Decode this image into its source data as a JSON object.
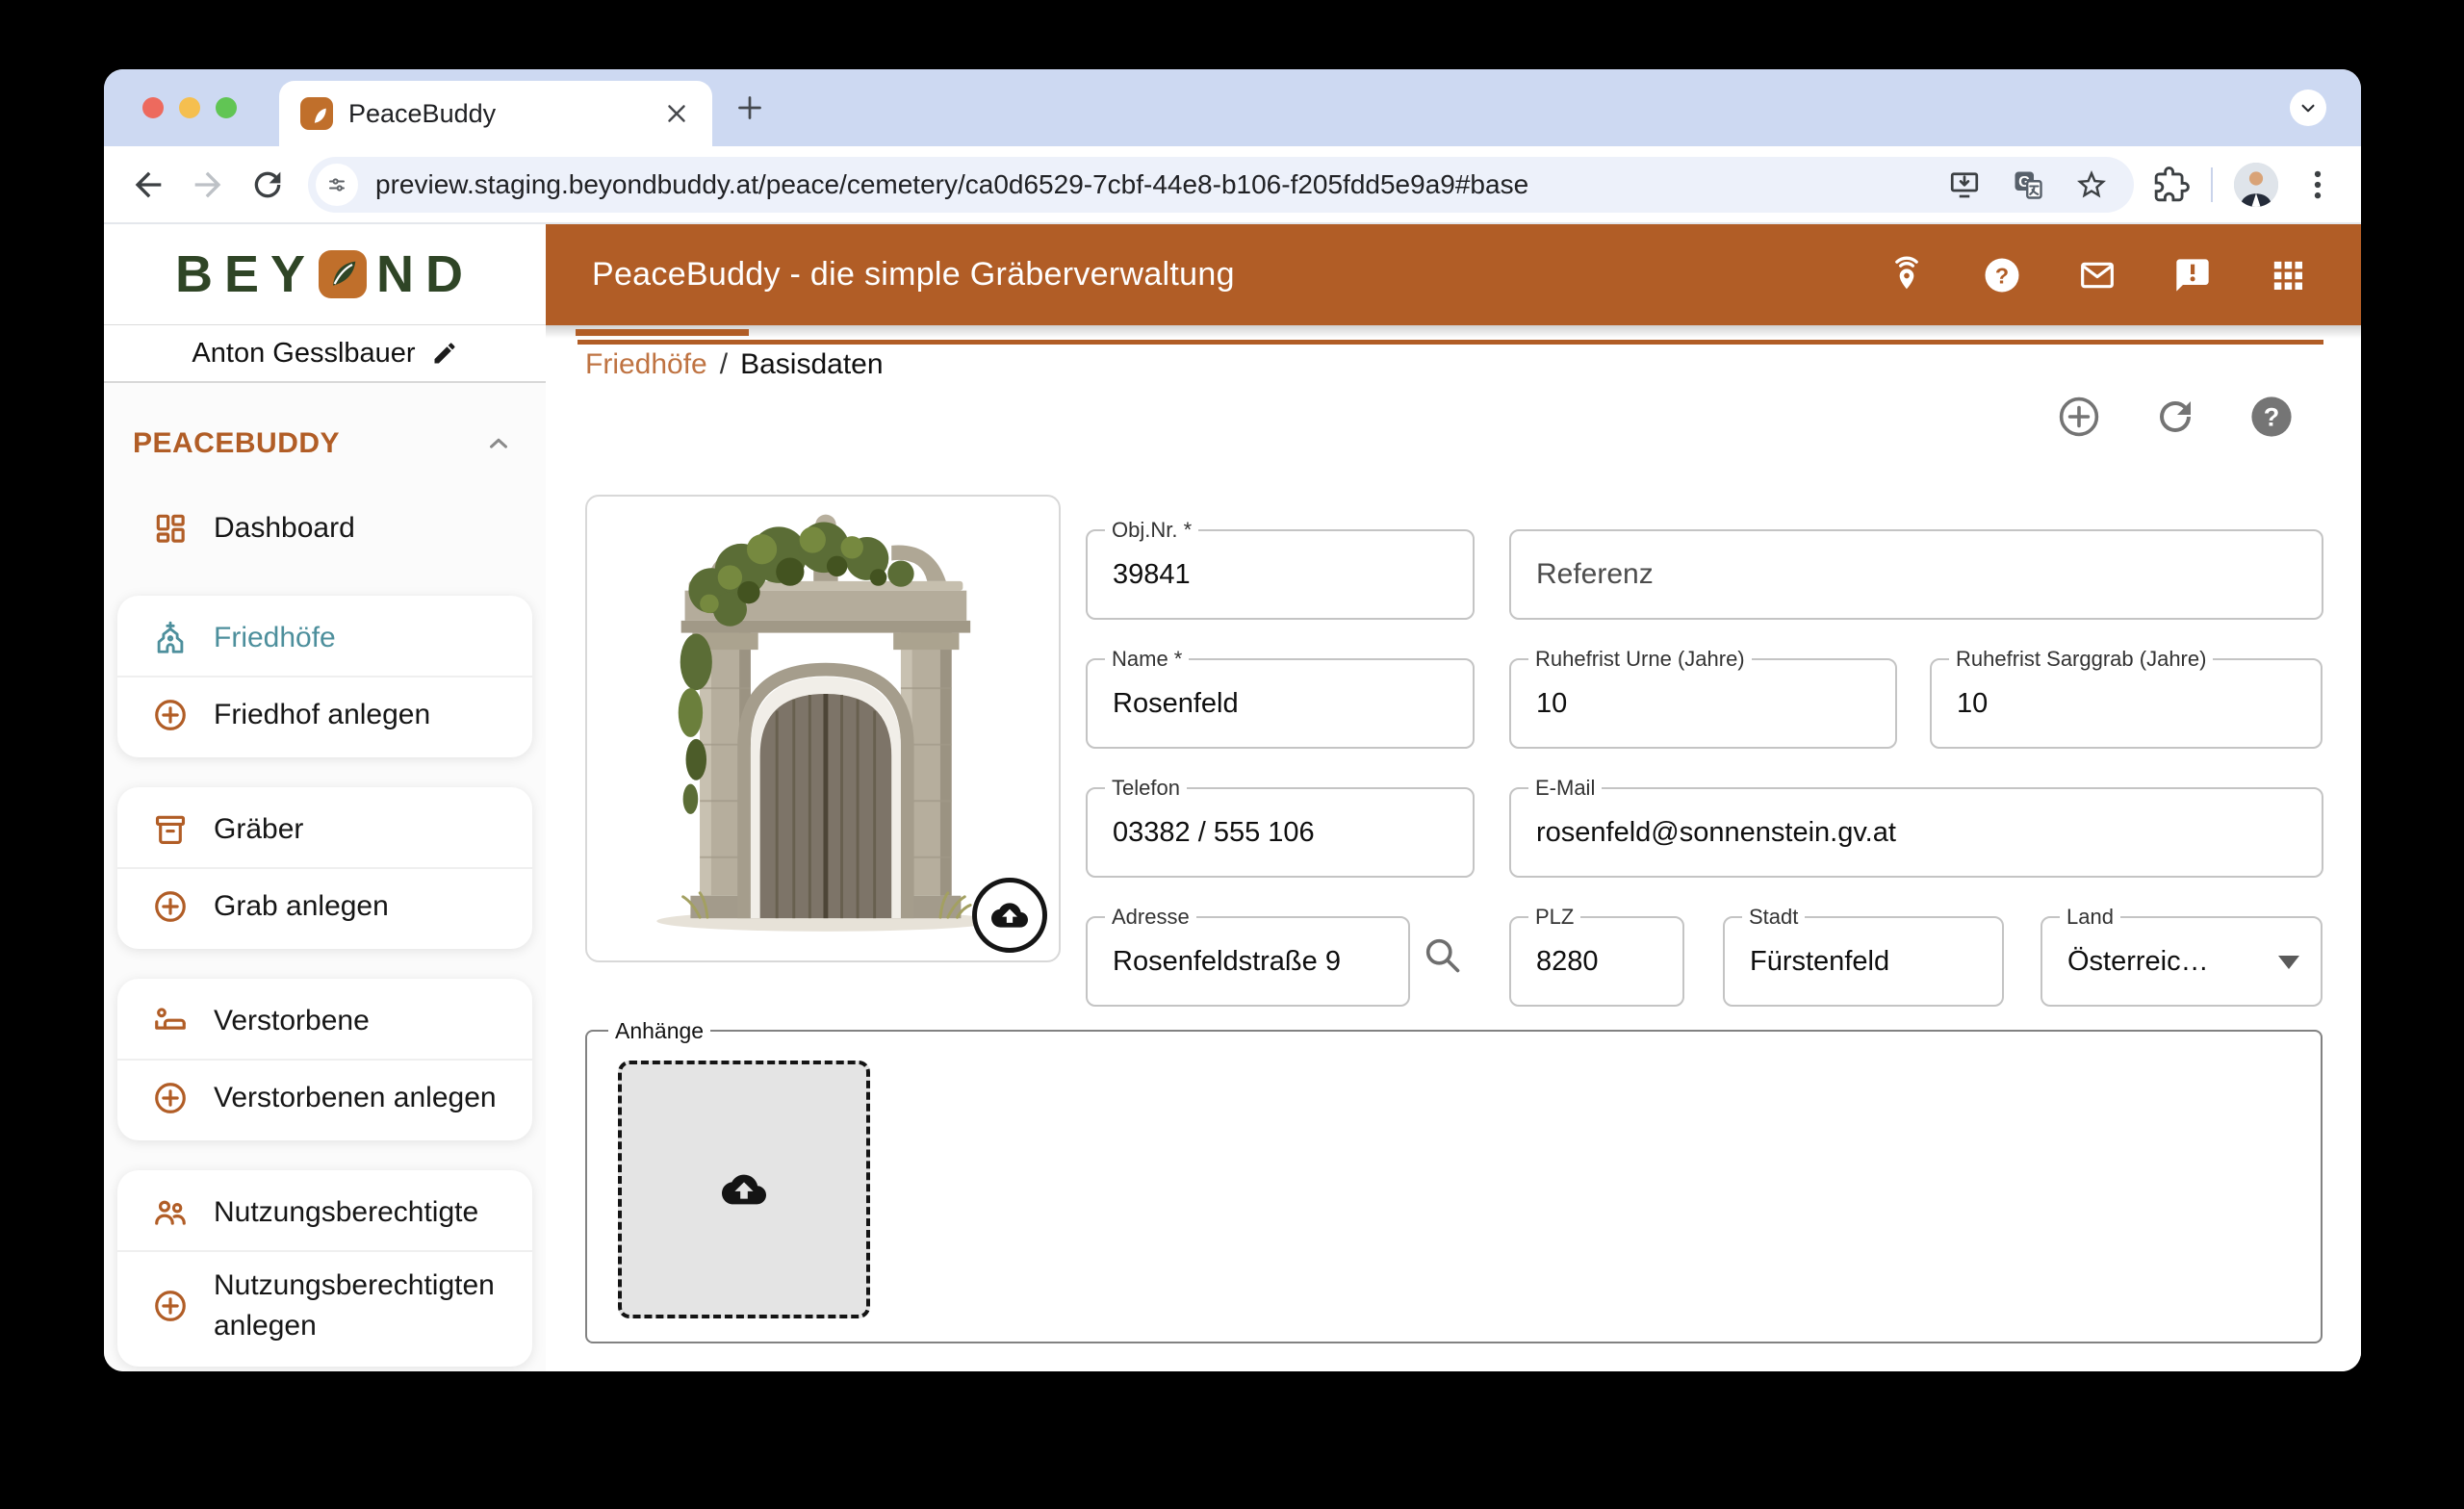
{
  "colors": {
    "accent_orange": "#b15d26",
    "breadcrumb_orange": "#bf7342",
    "active_teal": "#4d8f9c",
    "logo_green": "#2f4526",
    "chrome_strip": "#cdd9f2",
    "favicon_orange": "#c06f2b"
  },
  "browser": {
    "tab": {
      "title": "PeaceBuddy"
    },
    "address_bar": {
      "url": "preview.staging.beyondbuddy.at/peace/cemetery/ca0d6529-7cbf-44e8-b106-f205fdd5e9a9#base"
    },
    "icons": [
      "back-icon",
      "forward-icon",
      "reload-icon",
      "site-settings-icon",
      "install-icon",
      "translate-icon",
      "bookmark-star-icon",
      "extensions-icon",
      "profile-avatar",
      "menu-dots-icon",
      "new-tab-icon",
      "tab-search-icon",
      "close-tab-icon"
    ]
  },
  "appbar": {
    "title": "PeaceBuddy - die simple Gräberverwaltung",
    "icons": [
      "gps-location-icon",
      "help-icon",
      "mail-icon",
      "feedback-icon",
      "apps-grid-icon"
    ]
  },
  "sidebar": {
    "logo_left": "BEY",
    "logo_right": "ND",
    "user": "Anton Gesslbauer",
    "section": "PEACEBUDDY",
    "items": [
      {
        "label": "Dashboard",
        "icon": "dashboard-icon"
      },
      {
        "label": "Friedhöfe",
        "icon": "church-icon",
        "active": true
      },
      {
        "label": "Friedhof anlegen",
        "icon": "add-circle-icon"
      },
      {
        "label": "Gräber",
        "icon": "archive-box-icon"
      },
      {
        "label": "Grab anlegen",
        "icon": "add-circle-icon"
      },
      {
        "label": "Verstorbene",
        "icon": "deceased-bed-icon"
      },
      {
        "label": "Verstorbenen anlegen",
        "icon": "add-circle-icon"
      },
      {
        "label": "Nutzungsberechtigte",
        "icon": "people-icon"
      },
      {
        "label": "Nutzungsberechtigten anlegen",
        "icon": "add-circle-icon"
      }
    ]
  },
  "breadcrumb": {
    "parent": "Friedhöfe",
    "sep": "/",
    "current": "Basisdaten"
  },
  "content_actions": [
    "add-circle-icon",
    "refresh-icon",
    "help-filled-icon"
  ],
  "form": {
    "fields": {
      "obj_nr": {
        "label": "Obj.Nr. *",
        "value": "39841"
      },
      "referenz": {
        "label": "Referenz",
        "value": ""
      },
      "name": {
        "label": "Name *",
        "value": "Rosenfeld"
      },
      "ruhefrist_urne": {
        "label": "Ruhefrist Urne (Jahre)",
        "value": "10"
      },
      "ruhefrist_sarggrab": {
        "label": "Ruhefrist Sarggrab (Jahre)",
        "value": "10"
      },
      "telefon": {
        "label": "Telefon",
        "value": "03382 / 555 106"
      },
      "email": {
        "label": "E-Mail",
        "value": "rosenfeld@sonnenstein.gv.at"
      },
      "adresse": {
        "label": "Adresse",
        "value": "Rosenfeldstraße 9"
      },
      "plz": {
        "label": "PLZ",
        "value": "8280"
      },
      "stadt": {
        "label": "Stadt",
        "value": "Fürstenfeld"
      },
      "land": {
        "label": "Land",
        "value": "Österreic…"
      }
    },
    "attachments_legend": "Anhänge"
  }
}
